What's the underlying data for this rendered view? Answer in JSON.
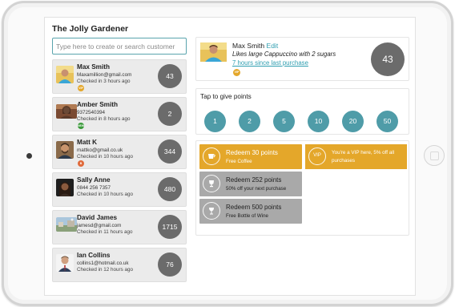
{
  "app": {
    "title": "The Jolly Gardener"
  },
  "search": {
    "placeholder": "Type here to create or search customer"
  },
  "customers": [
    {
      "name": "Max Smith",
      "email": "Maxamillion@gmail.com",
      "checkin": "Checked in 3 hours ago",
      "points": "43",
      "badge": "VIP",
      "badge_color": "#e4a72a"
    },
    {
      "name": "Amber Smith",
      "email": "9372540394",
      "checkin": "Checked in 8 hours ago",
      "points": "2",
      "badge": "NEW",
      "badge_color": "#3a9a3a"
    },
    {
      "name": "Matt K",
      "email": "mattko@gmail.co.uk",
      "checkin": "Checked in 10 hours ago",
      "points": "344",
      "badge": "B",
      "badge_color": "#e06a3a"
    },
    {
      "name": "Sally Anne",
      "email": "0844 256 7357",
      "checkin": "Checked in 10 hours ago",
      "points": "480"
    },
    {
      "name": "David James",
      "email": "jamesd@gmail.com",
      "checkin": "Checked in 11 hours ago",
      "points": "1715"
    },
    {
      "name": "Ian Collins",
      "email": "collins1@hotmail.co.uk",
      "checkin": "Checked in 12 hours ago",
      "points": "76"
    }
  ],
  "profile": {
    "name": "Max Smith",
    "edit_label": "Edit",
    "note": "Likes large Cappuccino with 2 sugars",
    "last_visit": "7 hours since last purchase",
    "badge": "VIP",
    "points": "43"
  },
  "give_points": {
    "title": "Tap to give points",
    "values": [
      "1",
      "2",
      "5",
      "10",
      "20",
      "50"
    ]
  },
  "rewards": [
    {
      "title": "Redeem 30 points",
      "desc": "Free Coffee",
      "style": "gold",
      "icon": "coffee-cup-icon"
    },
    {
      "title": "Redeem 252 points",
      "desc": "50% off your next purchase",
      "style": "grey",
      "icon": "trophy-icon"
    },
    {
      "title": "Redeem 500 points",
      "desc": "Free Bottle of Wine",
      "style": "grey",
      "icon": "wine-glass-icon"
    }
  ],
  "vip_tile": {
    "badge": "VIP",
    "text": "You're a VIP here, 5% off all purchases"
  },
  "colors": {
    "accent": "#5aa4ad",
    "point_button": "#4f9ca8",
    "gold": "#e4a72a",
    "grey_tile": "#a9a9a9",
    "points_circle": "#6b6b6b",
    "link": "#2f9eb0"
  }
}
